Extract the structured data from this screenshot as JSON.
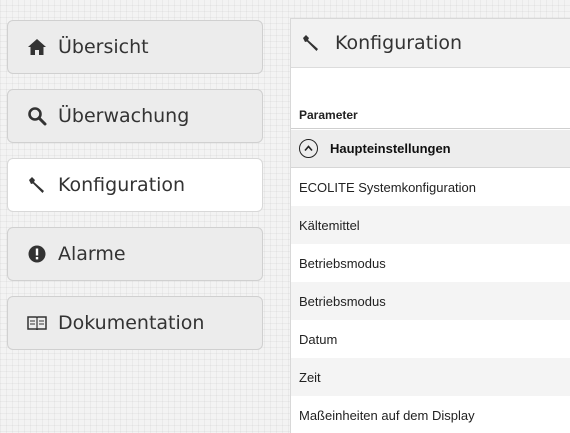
{
  "sidebar": {
    "items": [
      {
        "label": "Übersicht",
        "icon": "home-icon",
        "active": false
      },
      {
        "label": "Überwachung",
        "icon": "search-icon",
        "active": false
      },
      {
        "label": "Konfiguration",
        "icon": "wrench-icon",
        "active": true
      },
      {
        "label": "Alarme",
        "icon": "alert-icon",
        "active": false
      },
      {
        "label": "Dokumentation",
        "icon": "book-icon",
        "active": false
      }
    ]
  },
  "panel": {
    "title": "Konfiguration",
    "title_icon": "wrench-icon",
    "column_header": "Parameter",
    "group": {
      "label": "Haupteinstellungen",
      "icon": "chevron-up-circle-icon",
      "expanded": true
    },
    "rows": [
      "ECOLITE Systemkonfiguration",
      "Kältemittel",
      "Betriebsmodus",
      "Betriebsmodus",
      "Datum",
      "Zeit",
      "Maßeinheiten auf dem Display"
    ]
  },
  "colors": {
    "background": "#f3f3f3",
    "button": "#ececec",
    "button_active": "#ffffff",
    "panel_header": "#f2f2f2",
    "group_row": "#ededed",
    "text": "#333333"
  }
}
